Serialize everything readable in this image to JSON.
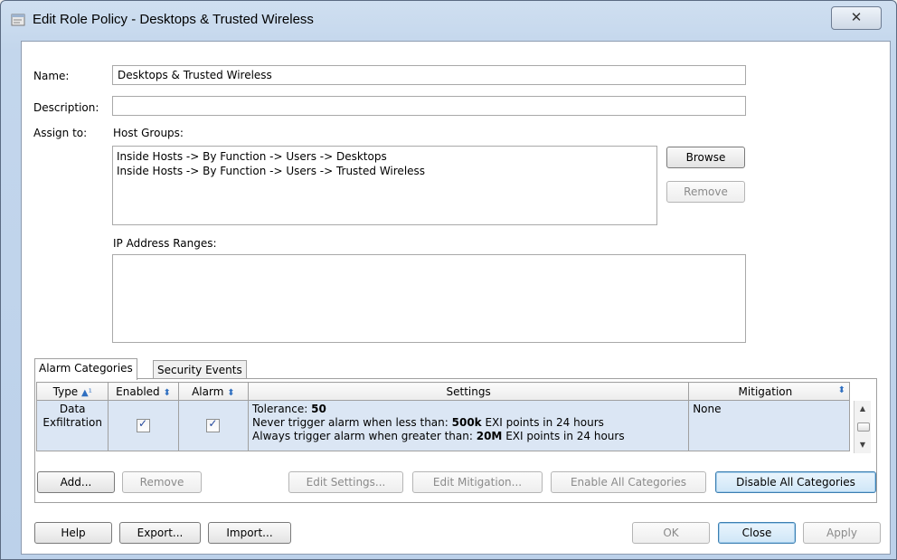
{
  "window": {
    "title": "Edit Role Policy - Desktops & Trusted Wireless",
    "close_symbol": "✕",
    "icon": "document-edit-icon"
  },
  "form": {
    "name_label": "Name:",
    "name_value": "Desktops & Trusted Wireless",
    "description_label": "Description:",
    "description_value": "",
    "assign_label": "Assign to:",
    "host_groups_label": "Host Groups:",
    "host_groups": [
      "Inside Hosts -> By Function -> Users -> Desktops",
      "Inside Hosts -> By Function -> Users -> Trusted Wireless"
    ],
    "browse_label": "Browse",
    "remove_label": "Remove",
    "ip_ranges_label": "IP Address Ranges:"
  },
  "tabs": [
    "Alarm Categories",
    "Security Events"
  ],
  "table": {
    "columns": {
      "type": "Type",
      "type_sort": "▲¹",
      "enabled": "Enabled",
      "alarm": "Alarm",
      "settings": "Settings",
      "mitigation": "Mitigation",
      "sort_icon": "⬍"
    },
    "rows": [
      {
        "type": "Data Exfiltration",
        "enabled": true,
        "alarm": true,
        "settings": {
          "tolerance_label": "Tolerance: ",
          "tolerance_value": "50",
          "never_prefix": "Never trigger alarm when less than: ",
          "never_value": "500k",
          "never_suffix": " EXI points in 24 hours",
          "always_prefix": "Always trigger alarm when greater than: ",
          "always_value": "20M",
          "always_suffix": " EXI points in 24 hours"
        },
        "mitigation": "None"
      }
    ]
  },
  "table_buttons": {
    "add": "Add...",
    "remove": "Remove",
    "edit_settings": "Edit Settings...",
    "edit_mitigation": "Edit Mitigation...",
    "enable_all": "Enable All Categories",
    "disable_all": "Disable All Categories"
  },
  "footer_buttons": {
    "help": "Help",
    "export": "Export...",
    "import": "Import...",
    "ok": "OK",
    "close": "Close",
    "apply": "Apply"
  }
}
